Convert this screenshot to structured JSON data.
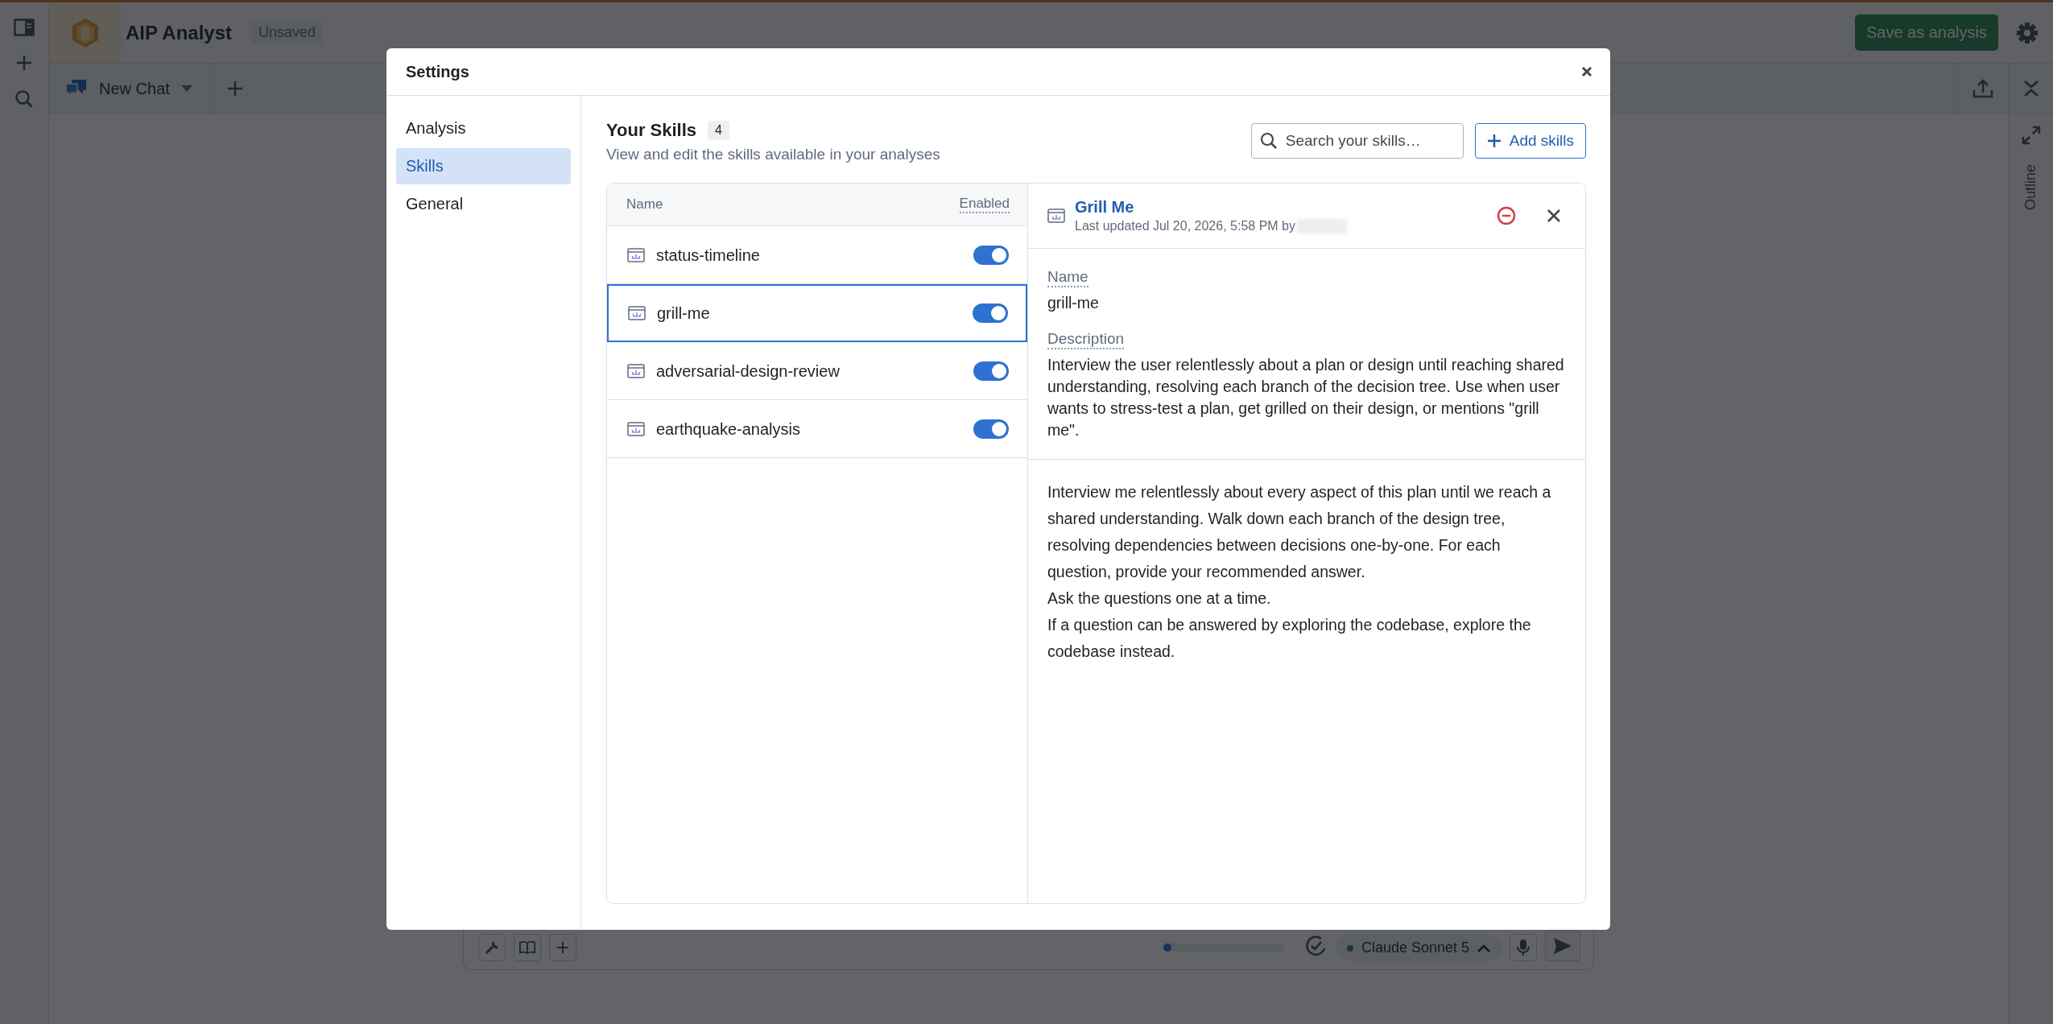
{
  "app": {
    "title": "AIP Analyst",
    "status": "Unsaved",
    "save_button": "Save as analysis"
  },
  "tabs": [
    {
      "label": "New Chat"
    }
  ],
  "side_panel": {
    "label": "Outline"
  },
  "composer": {
    "level": 0.03,
    "model": "Claude Sonnet 5"
  },
  "dialog": {
    "title": "Settings",
    "nav": [
      {
        "label": "Analysis",
        "selected": false
      },
      {
        "label": "Skills",
        "selected": true
      },
      {
        "label": "General",
        "selected": false
      }
    ],
    "skills": {
      "title": "Your Skills",
      "count": "4",
      "subtitle": "View and edit the skills available in your analyses",
      "search_placeholder": "Search your skills…",
      "add_button": "Add skills",
      "columns": [
        "Name",
        "Enabled"
      ],
      "items": [
        {
          "name": "status-timeline",
          "enabled": true,
          "selected": false
        },
        {
          "name": "grill-me",
          "enabled": true,
          "selected": true
        },
        {
          "name": "adversarial-design-review",
          "enabled": true,
          "selected": false
        },
        {
          "name": "earthquake-analysis",
          "enabled": true,
          "selected": false
        }
      ]
    },
    "detail": {
      "title": "Grill Me",
      "updated": "Last updated Jul 20, 2026, 5:58 PM by",
      "fields": [
        {
          "label": "Name",
          "value": "grill-me"
        },
        {
          "label": "Description",
          "value": "Interview the user relentlessly about a plan or design until reaching shared understanding, resolving each branch of the decision tree. Use when user wants to stress-test a plan, get grilled on their design, or mentions \"grill me\"."
        }
      ],
      "instructions": [
        "Interview me relentlessly about every aspect of this plan until we reach a shared understanding. Walk down each branch of the design tree, resolving dependencies between decisions one-by-one. For each question, provide your recommended answer.",
        "Ask the questions one at a time.",
        "If a question can be answered by exploring the codebase, explore the codebase instead."
      ]
    }
  }
}
